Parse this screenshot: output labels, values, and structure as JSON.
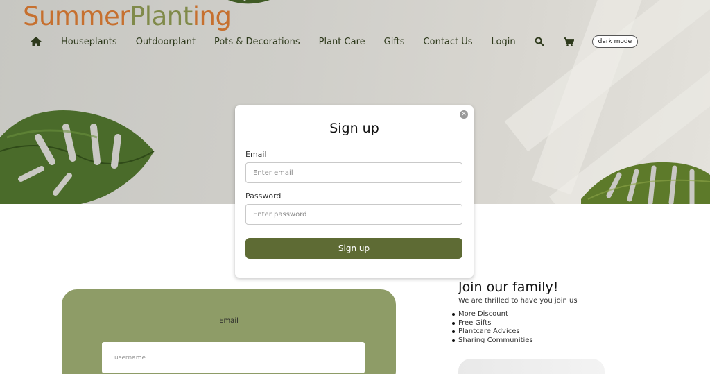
{
  "brand": {
    "part1": "Summer",
    "part2": "Plant",
    "part3": "ing"
  },
  "nav": {
    "home_icon": "home-icon",
    "items": [
      "Houseplants",
      "Outdoorplant",
      "Pots & Decorations",
      "Plant Care",
      "Gifts",
      "Contact Us",
      "Login"
    ],
    "search_icon": "search-icon",
    "cart_icon": "cart-icon",
    "dark_mode_label": "dark mode"
  },
  "modal": {
    "title": "Sign up",
    "close_icon": "close-icon",
    "email_label": "Email",
    "email_placeholder": "Enter email",
    "password_label": "Password",
    "password_placeholder": "Enter password",
    "submit_label": "Sign up"
  },
  "subscribe_card": {
    "email_label": "Email",
    "username_placeholder": "username"
  },
  "join": {
    "title": "Join our family!",
    "subtitle": "We are thrilled to have you join us",
    "benefits": [
      "More Discount",
      "Free Gifts",
      "Plantcare Advices",
      "Sharing Communities"
    ]
  },
  "colors": {
    "brand_orange": "#c6702f",
    "brand_green": "#808a4a",
    "button_green": "#5e6b34",
    "card_green": "#8e9c67"
  }
}
